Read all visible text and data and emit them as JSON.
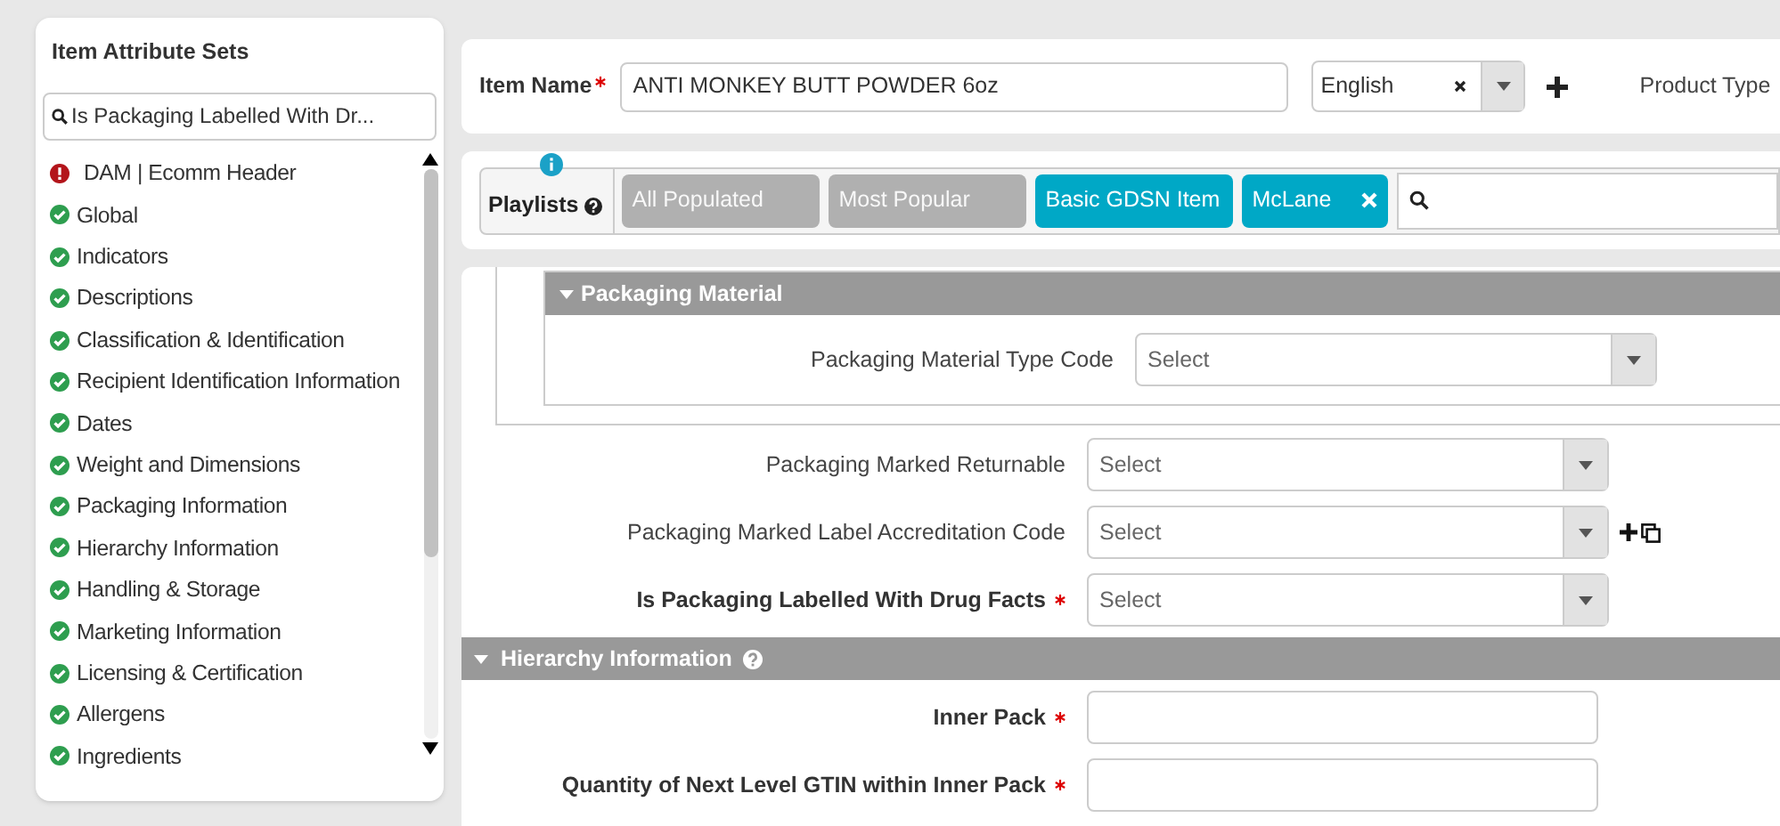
{
  "sidebar": {
    "title": "Item Attribute Sets",
    "search": {
      "value": "Is Packaging Labelled With Dr..."
    },
    "items": [
      {
        "label": "DAM | Ecomm Header",
        "kind": "error"
      },
      {
        "label": "Global",
        "kind": "ok"
      },
      {
        "label": "Indicators",
        "kind": "ok"
      },
      {
        "label": "Descriptions",
        "kind": "ok"
      },
      {
        "label": "Classification & Identification",
        "kind": "ok"
      },
      {
        "label": "Recipient Identification Information",
        "kind": "ok"
      },
      {
        "label": "Dates",
        "kind": "ok"
      },
      {
        "label": "Weight and Dimensions",
        "kind": "ok"
      },
      {
        "label": "Packaging Information",
        "kind": "ok"
      },
      {
        "label": "Hierarchy Information",
        "kind": "ok"
      },
      {
        "label": "Handling & Storage",
        "kind": "ok"
      },
      {
        "label": "Marketing Information",
        "kind": "ok"
      },
      {
        "label": "Licensing & Certification",
        "kind": "ok"
      },
      {
        "label": "Allergens",
        "kind": "ok"
      },
      {
        "label": "Ingredients",
        "kind": "ok"
      }
    ]
  },
  "header": {
    "item_name_label": "Item Name",
    "item_name_value": "ANTI MONKEY BUTT POWDER 6oz",
    "language": "English",
    "product_type_label": "Product Type"
  },
  "playlists": {
    "label": "Playlists",
    "chips": [
      {
        "label": "All Populated",
        "selected": false,
        "removable": false
      },
      {
        "label": "Most Popular",
        "selected": false,
        "removable": false
      },
      {
        "label": "Basic GDSN Item",
        "selected": true,
        "removable": false
      },
      {
        "label": "McLane",
        "selected": true,
        "removable": true
      }
    ]
  },
  "sections": [
    {
      "title": "Packaging Material",
      "kind": "subsection",
      "fields": [
        {
          "label": "Packaging Material Type Code",
          "kind": "select",
          "placeholder": "Select",
          "required": false,
          "add_copy": false
        }
      ]
    },
    {
      "kind": "fields",
      "fields": [
        {
          "label": "Packaging Marked Returnable",
          "kind": "select",
          "placeholder": "Select",
          "required": false,
          "add_copy": false
        },
        {
          "label": "Packaging Marked Label Accreditation Code",
          "kind": "select",
          "placeholder": "Select",
          "required": false,
          "add_copy": true
        },
        {
          "label": "Is Packaging Labelled With Drug Facts",
          "kind": "select",
          "placeholder": "Select",
          "required": true,
          "add_copy": false
        }
      ]
    },
    {
      "title": "Hierarchy Information",
      "kind": "section",
      "help": true,
      "fields": [
        {
          "label": "Inner Pack",
          "kind": "text",
          "required": true,
          "add_copy": false
        },
        {
          "label": "Quantity of Next Level GTIN within Inner Pack",
          "kind": "text",
          "required": true,
          "add_copy": false
        }
      ]
    }
  ]
}
